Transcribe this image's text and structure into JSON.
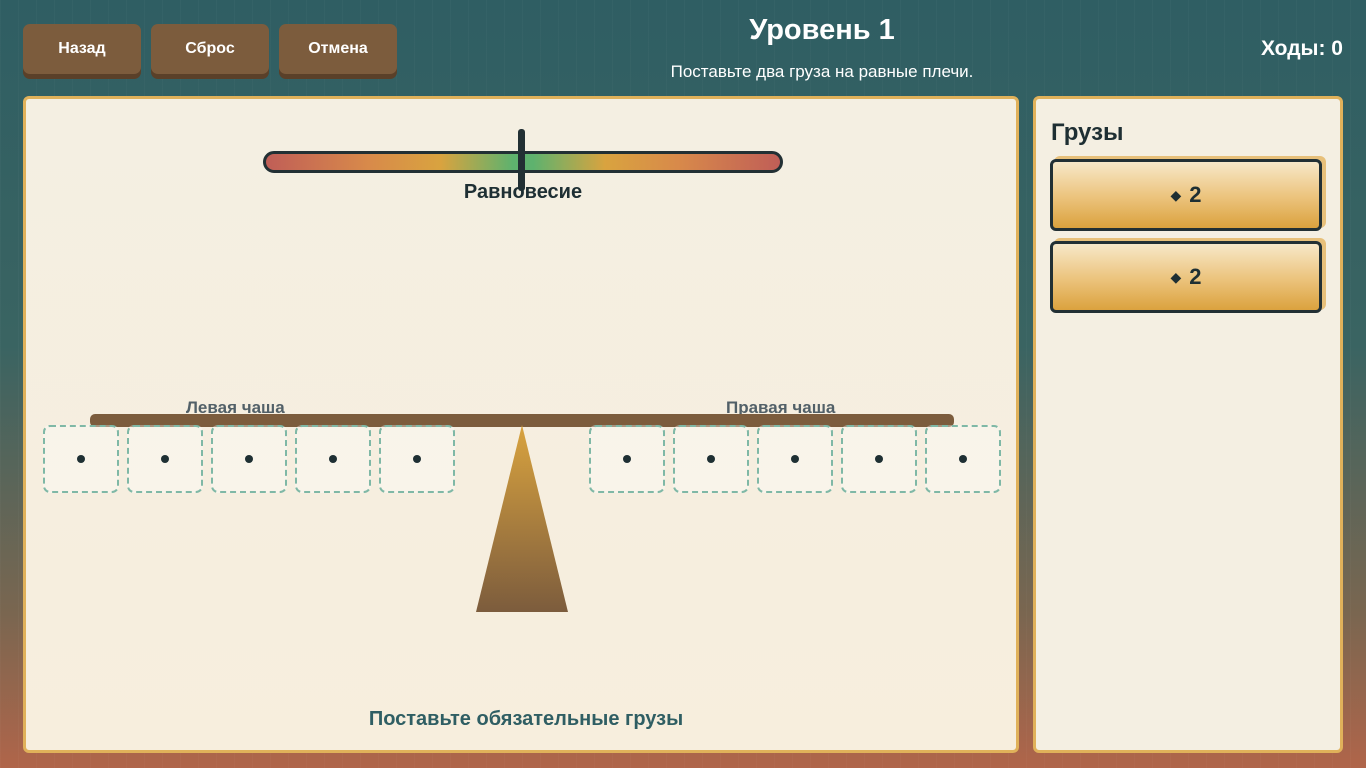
{
  "toolbar": {
    "back_label": "Назад",
    "reset_label": "Сброс",
    "undo_label": "Отмена"
  },
  "level": {
    "title": "Уровень 1",
    "subtitle": "Поставьте два груза на равные плечи."
  },
  "moves": {
    "text": "Ходы: 0",
    "count": 0
  },
  "meter": {
    "label": "Равновесие",
    "balance": 0
  },
  "scale": {
    "left_label": "Левая чаша",
    "right_label": "Правая чаша",
    "left_slots": 5,
    "right_slots": 5,
    "slot_marker": "•"
  },
  "hint": "Поставьте обязательные грузы",
  "weights_panel": {
    "title": "Грузы",
    "items": [
      {
        "icon": "diamond-icon",
        "symbol": "◆",
        "value": "2"
      },
      {
        "icon": "diamond-icon",
        "symbol": "◆",
        "value": "2"
      }
    ]
  },
  "colors": {
    "button": "#7c5c3d",
    "board_border": "#e0b15a",
    "slot_border": "#7fb8a6",
    "text_dark": "#1e2f33"
  }
}
